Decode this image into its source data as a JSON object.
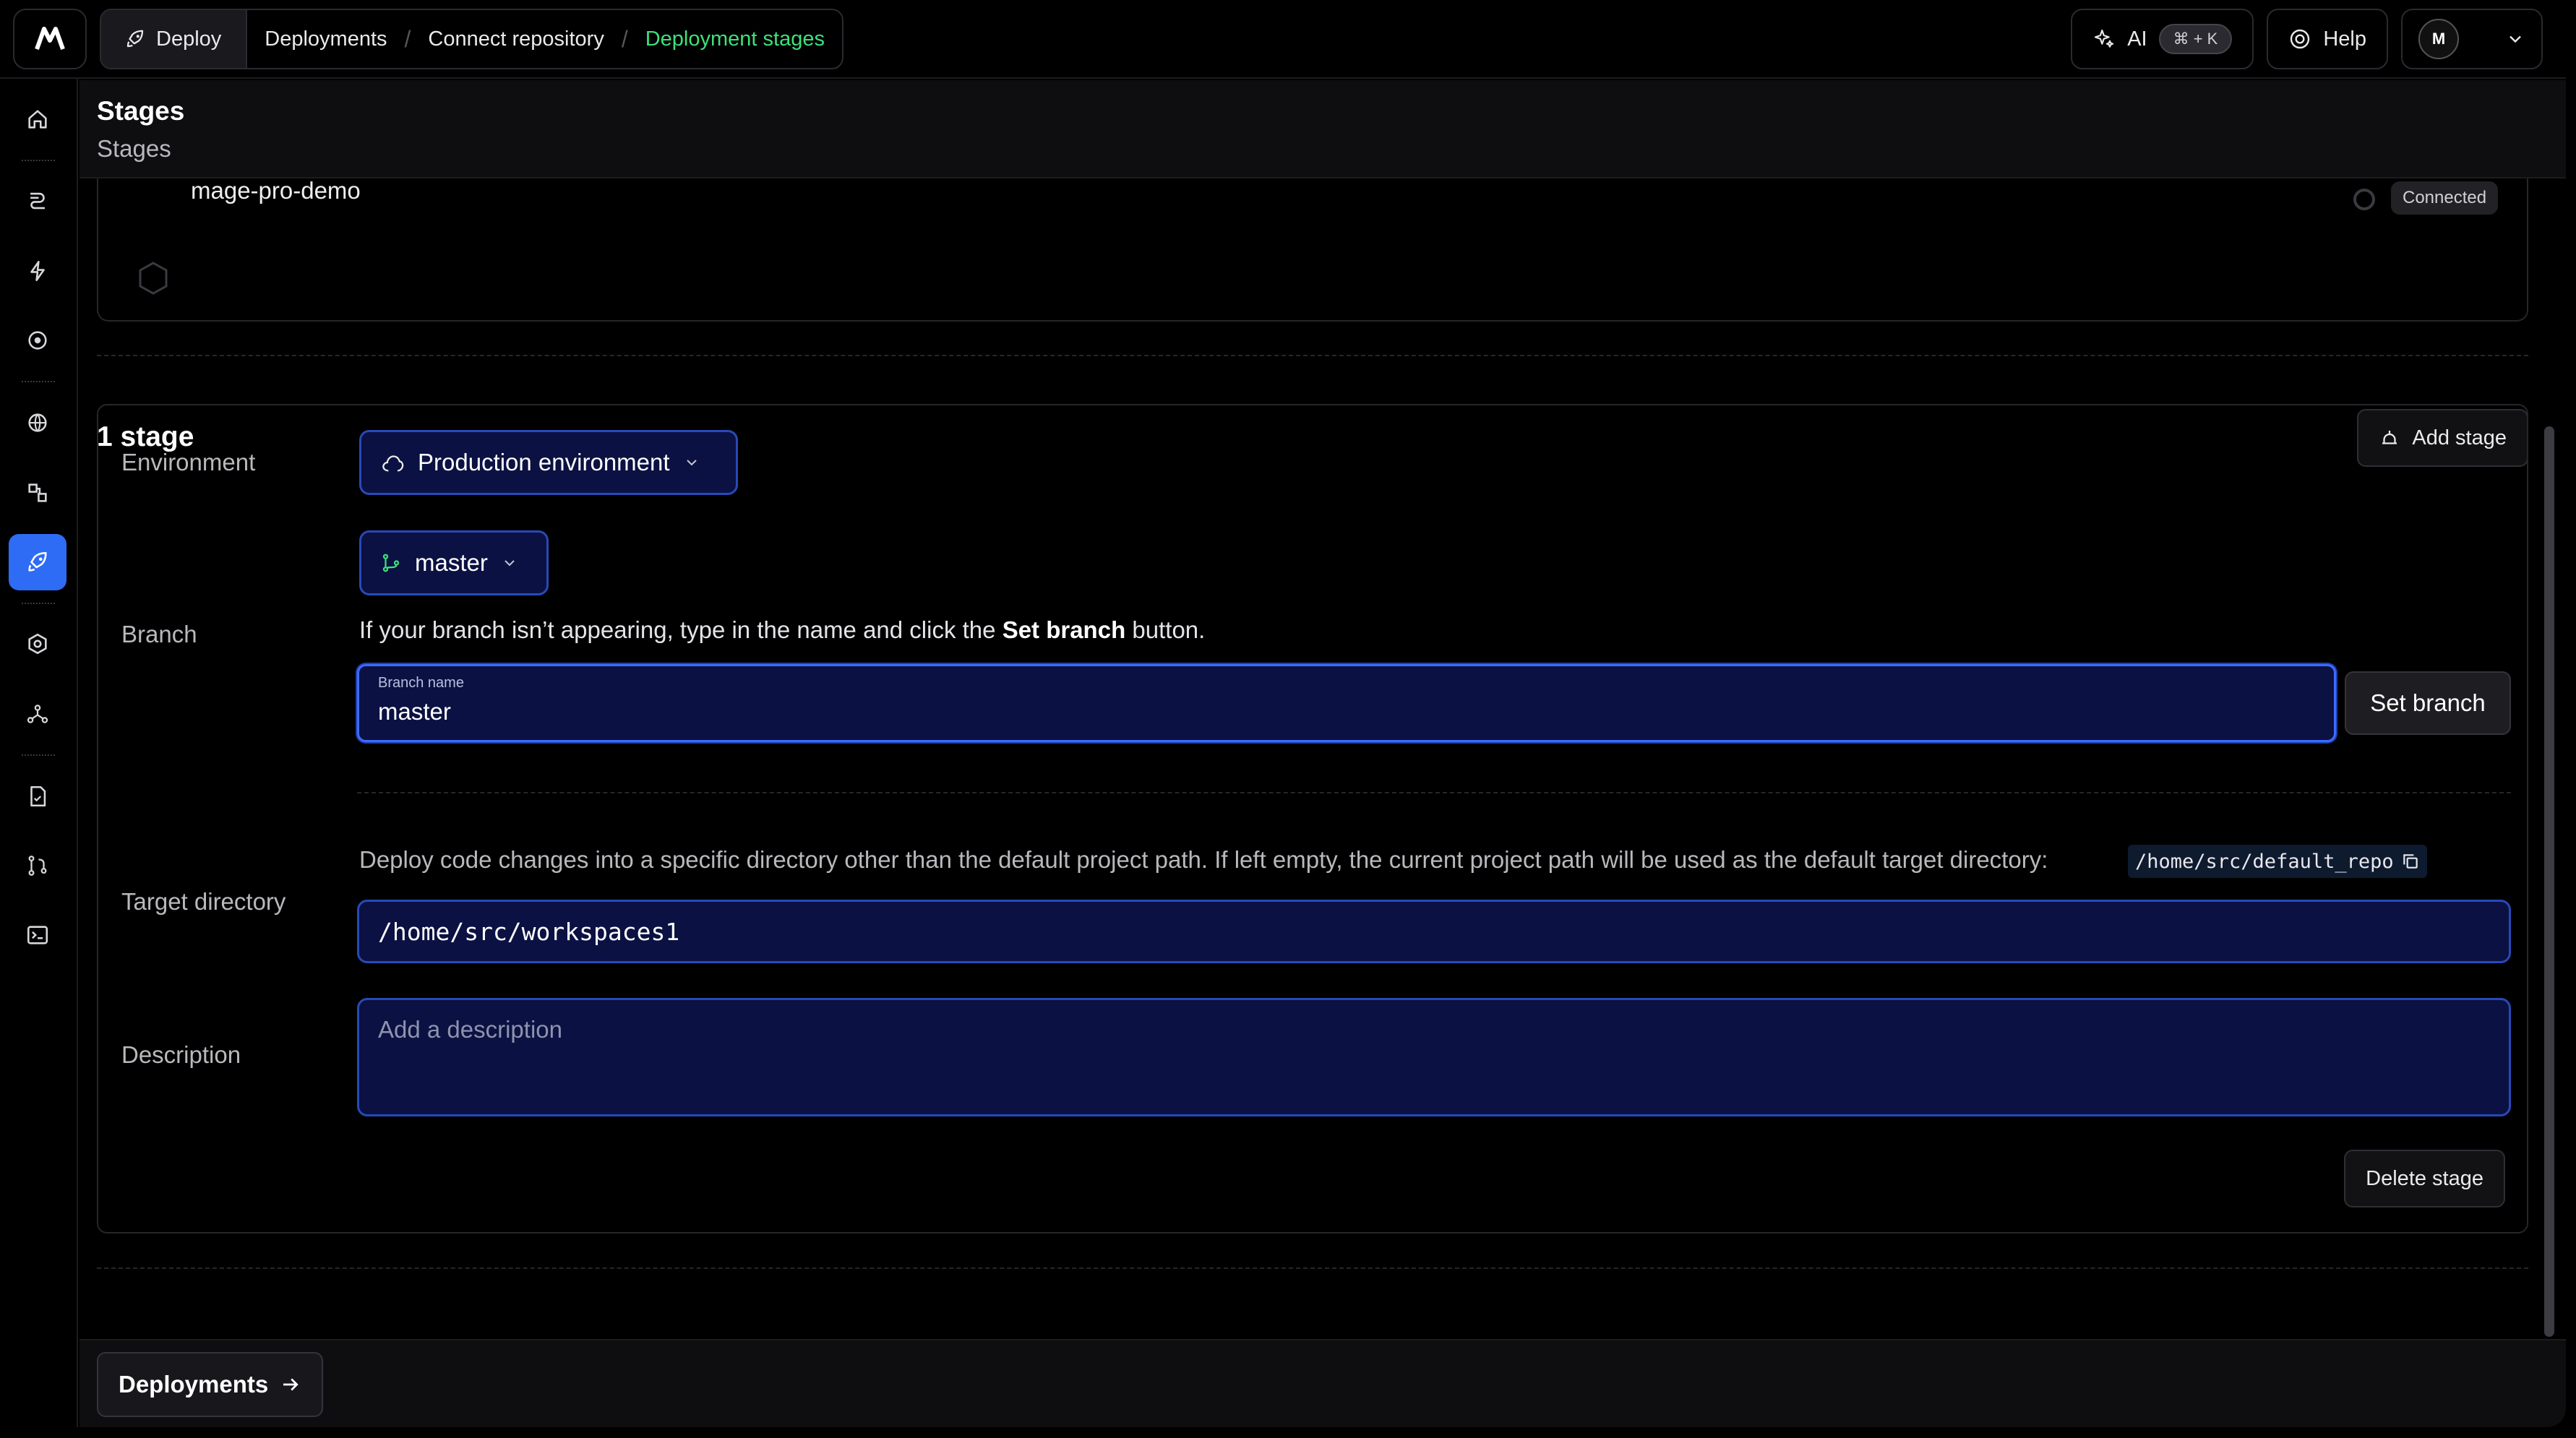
{
  "header": {
    "logo_text": "M",
    "breadcrumb": {
      "deploy": "Deploy",
      "items": [
        "Deployments",
        "Connect repository",
        "Deployment stages"
      ]
    },
    "ai_label": "AI",
    "ai_shortcut": "⌘ + K",
    "help_label": "Help"
  },
  "page": {
    "title": "Stages",
    "subtitle": "Stages"
  },
  "repository": {
    "name": "mage-pro-demo",
    "status": "Connected"
  },
  "stages": {
    "count_label": "1 stage",
    "add_label": "Add stage",
    "environment_label": "Environment",
    "environment_value": "Production environment",
    "branch_label": "Branch",
    "branch_value": "master",
    "branch_hint_pre": "If your branch isn’t appearing, type in the name and click the ",
    "branch_hint_bold": "Set branch",
    "branch_hint_post": " button.",
    "branch_input_label": "Branch name",
    "branch_input_value": "master",
    "set_branch_label": "Set branch",
    "target_label": "Target directory",
    "target_hint": "Deploy code changes into a specific directory other than the default project path. If left empty, the current project path will be used as the default target directory:",
    "default_path": "/home/src/default_repo",
    "target_value": "/home/src/workspaces1",
    "description_label": "Description",
    "description_placeholder": "Add a description",
    "delete_label": "Delete stage"
  },
  "footer": {
    "deployments_label": "Deployments"
  },
  "colors": {
    "accent": "#2f6cf5",
    "active_crumb": "#3ee07a",
    "input_bg": "#0b1142"
  }
}
